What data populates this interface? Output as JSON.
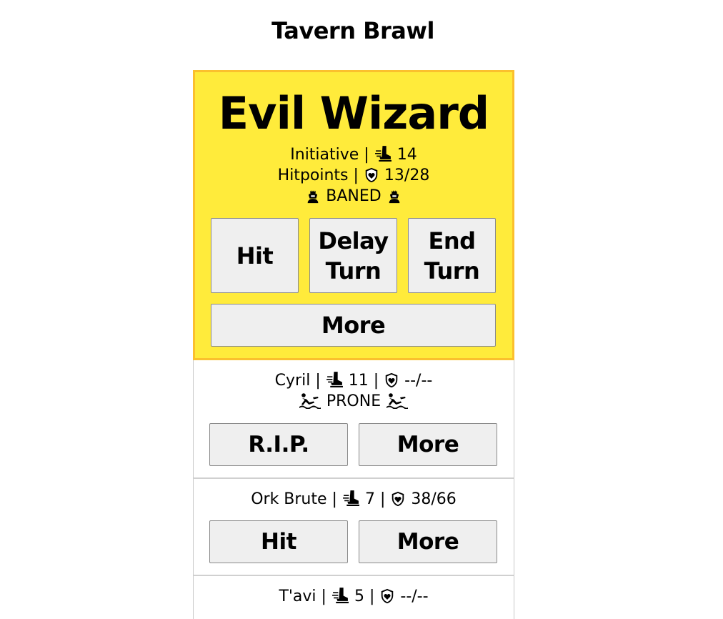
{
  "title": "Tavern Brawl",
  "active": {
    "name": "Evil Wizard",
    "initiative_label": "Initiative |",
    "initiative": "14",
    "hitpoints_label": "Hitpoints |",
    "hitpoints": "13/28",
    "condition": "BANED",
    "buttons": {
      "hit": "Hit",
      "delay": "Delay Turn",
      "end": "End Turn",
      "more": "More"
    }
  },
  "combatants": [
    {
      "name": "Cyril",
      "initiative": "11",
      "hitpoints": "--/--",
      "condition": "PRONE",
      "primary_button": "R.I.P.",
      "more_button": "More"
    },
    {
      "name": "Ork Brute",
      "initiative": "7",
      "hitpoints": "38/66",
      "primary_button": "Hit",
      "more_button": "More"
    },
    {
      "name": "T'avi",
      "initiative": "5",
      "hitpoints": "--/--"
    }
  ],
  "separator": "|",
  "colors": {
    "active_bg": "#ffeb3b",
    "active_border": "#fbc02d",
    "button_bg": "#efefef"
  },
  "icons": {
    "initiative": "winged-boot-icon",
    "hitpoints": "heart-shield-icon",
    "baned": "hooded-figure-icon",
    "prone": "prone-swimmer-icon"
  }
}
